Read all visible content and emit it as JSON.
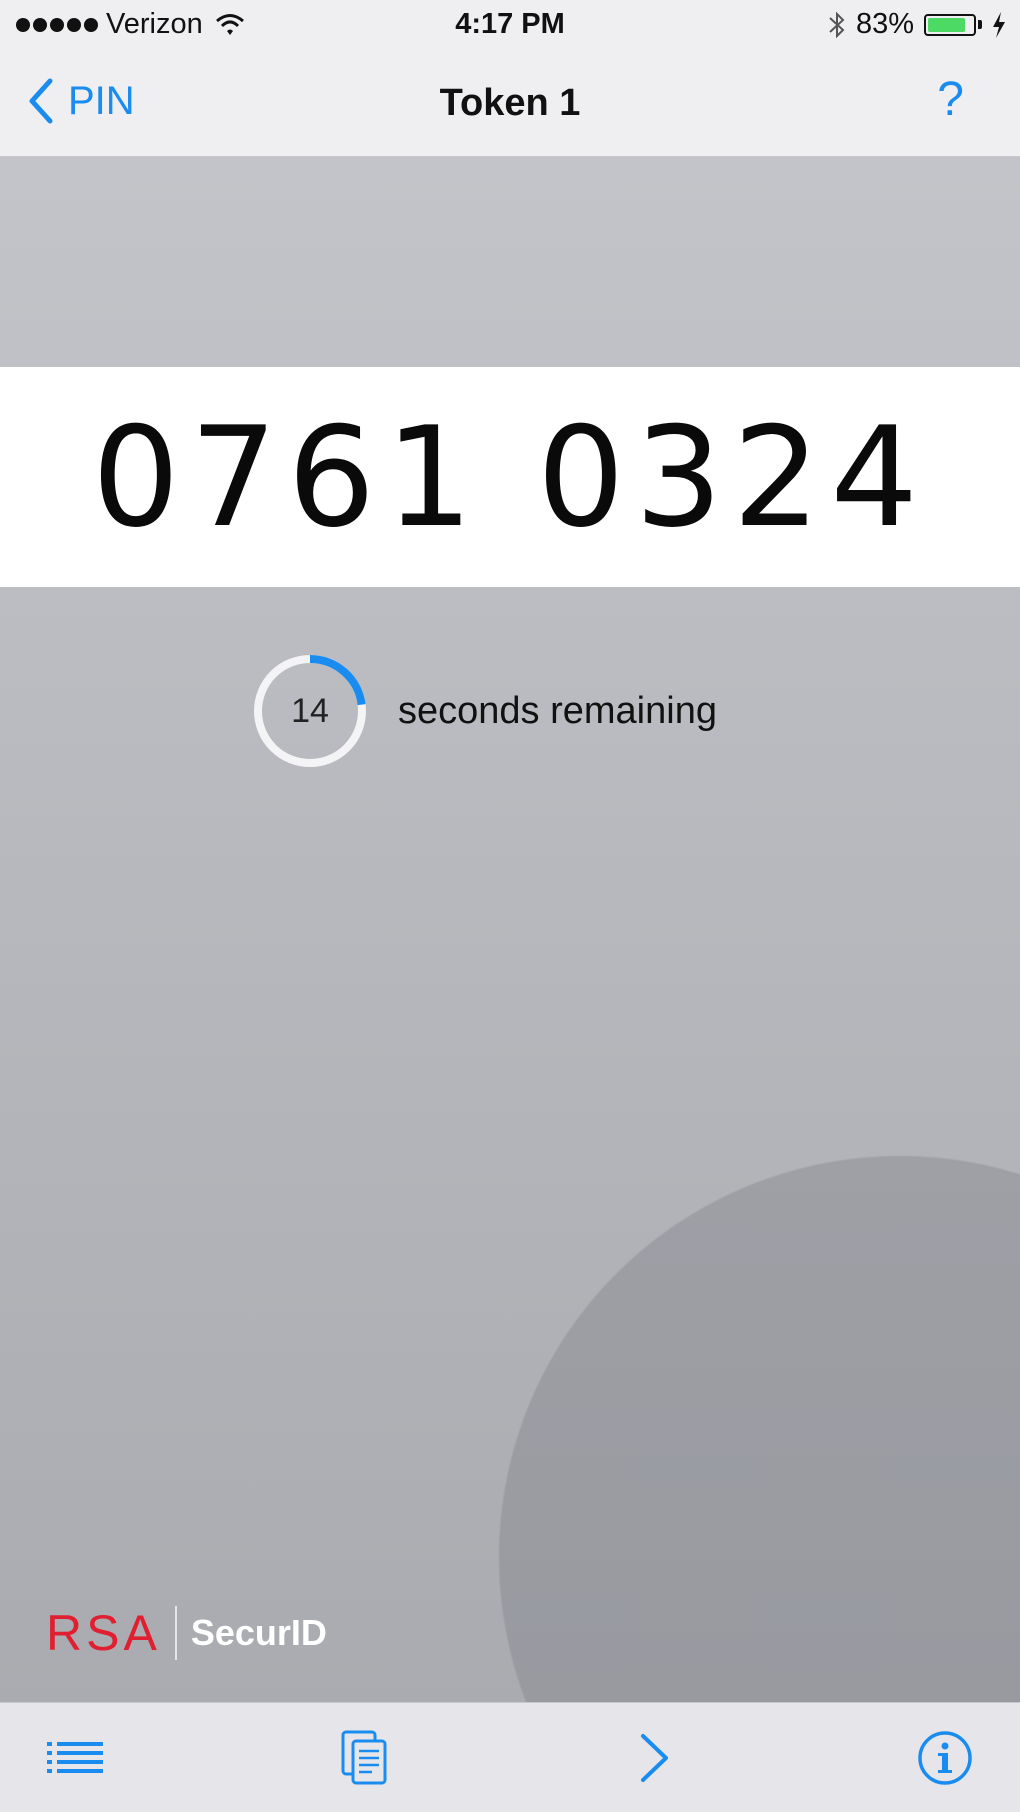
{
  "status_bar": {
    "carrier": "Verizon",
    "time": "4:17 PM",
    "battery_percent_label": "83%",
    "battery_level": 0.83
  },
  "nav": {
    "back_label": "PIN",
    "title": "Token 1",
    "help_label": "?"
  },
  "token": {
    "code": "0761 0324"
  },
  "timer": {
    "seconds": "14",
    "label": "seconds remaining",
    "fraction_remaining": 0.23
  },
  "brand": {
    "logo": "RSA",
    "product": "SecurID"
  },
  "toolbar": {
    "items": [
      {
        "icon": "list-icon"
      },
      {
        "icon": "copy-icon"
      },
      {
        "icon": "chevron-right-icon"
      },
      {
        "icon": "info-icon"
      }
    ]
  },
  "colors": {
    "accent": "#1a8cf0",
    "brand_red": "#e02031",
    "battery_green": "#4cd964"
  }
}
